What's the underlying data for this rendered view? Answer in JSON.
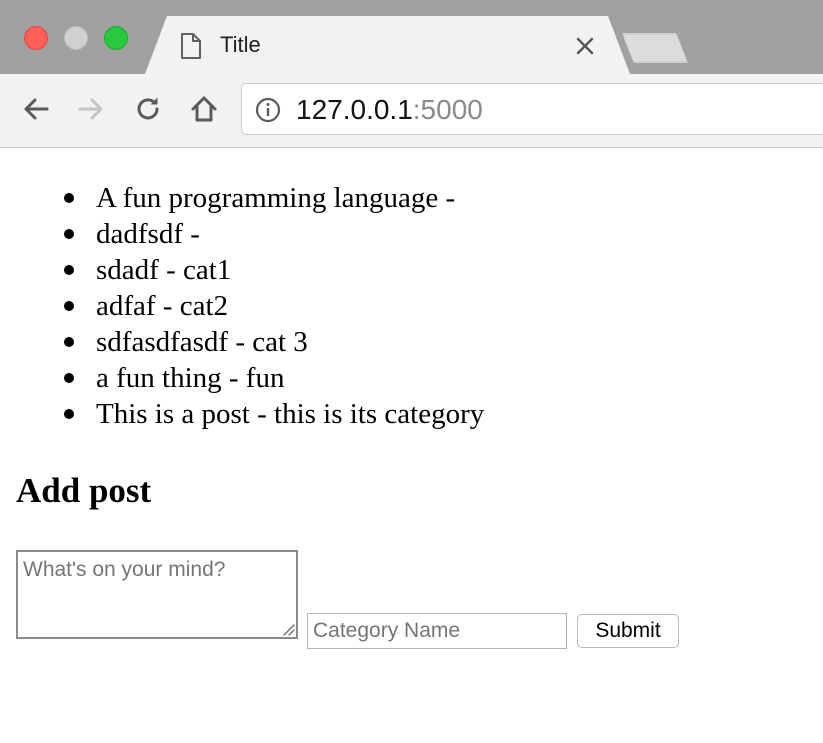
{
  "browser": {
    "tab_title": "Title",
    "url_host": "127.0.0.1",
    "url_port": ":5000",
    "icons": {
      "close_window": "close-window-icon",
      "minimize_window": "minimize-window-icon",
      "maximize_window": "maximize-window-icon",
      "tab_page": "page-icon",
      "tab_close": "close-icon",
      "back": "back-arrow-icon",
      "forward": "forward-arrow-icon",
      "reload": "reload-icon",
      "home": "home-icon",
      "site_info": "info-icon"
    },
    "colors": {
      "close_window": "#ff5f57",
      "maximize_window": "#28c840"
    }
  },
  "posts": [
    "A fun programming language -",
    "dadfsdf -",
    "sdadf - cat1",
    "adfaf - cat2",
    "sdfasdfasdf - cat 3",
    "a fun thing - fun",
    "This is a post - this is its category"
  ],
  "form": {
    "heading": "Add post",
    "post_placeholder": "What's on your mind?",
    "post_value": "",
    "category_placeholder": "Category Name",
    "category_value": "",
    "submit_label": "Submit"
  }
}
